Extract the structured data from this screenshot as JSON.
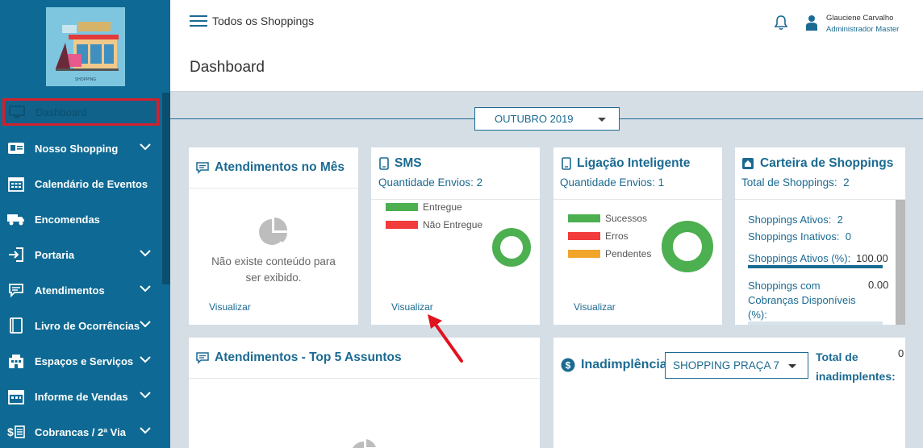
{
  "header": {
    "title": "Todos os Shoppings",
    "page_title": "Dashboard",
    "user_name": "Glauciene Carvalho",
    "user_role": "Administrador Master"
  },
  "sidebar": {
    "logo_caption": "SHOPPING",
    "items": [
      {
        "label": "Dashboard",
        "icon": "monitor-icon",
        "active": true
      },
      {
        "label": "Nosso Shopping",
        "icon": "id-card-icon",
        "expandable": true
      },
      {
        "label": "Calendário de Eventos",
        "icon": "calendar-icon"
      },
      {
        "label": "Encomendas",
        "icon": "truck-icon"
      },
      {
        "label": "Portaria",
        "icon": "door-enter-icon",
        "expandable": true
      },
      {
        "label": "Atendimentos",
        "icon": "chat-icon",
        "expandable": true
      },
      {
        "label": "Livro de Ocorrências",
        "icon": "book-icon",
        "expandable": true
      },
      {
        "label": "Espaços e Serviços",
        "icon": "building-icon",
        "expandable": true
      },
      {
        "label": "Informe de Vendas",
        "icon": "store-icon",
        "expandable": true
      },
      {
        "label": "Cobrancas / 2ª Via",
        "icon": "dollar-list-icon",
        "expandable": true
      }
    ]
  },
  "month_selector": {
    "value": "OUTUBRO 2019"
  },
  "cards": {
    "atendimentos_mes": {
      "title": "Atendimentos no Mês",
      "empty_line1": "Não existe conteúdo para",
      "empty_line2": "ser exibido.",
      "link": "Visualizar"
    },
    "sms": {
      "title": "SMS",
      "sub_label": "Quantidade Envios:",
      "sub_value": "2",
      "legend": [
        {
          "label": "Entregue",
          "color": "#4caf50"
        },
        {
          "label": "Não Entregue",
          "color": "#f23b3b"
        }
      ],
      "link": "Visualizar"
    },
    "ligacao": {
      "title": "Ligação Inteligente",
      "sub_label": "Quantidade Envios:",
      "sub_value": "1",
      "legend": [
        {
          "label": "Sucessos",
          "color": "#4caf50"
        },
        {
          "label": "Erros",
          "color": "#f23b3b"
        },
        {
          "label": "Pendentes",
          "color": "#f2a52b"
        }
      ],
      "link": "Visualizar"
    },
    "carteira": {
      "title": "Carteira de Shoppings",
      "sub_label": "Total de Shoppings:",
      "sub_value": "2",
      "ativos_label": "Shoppings Ativos:",
      "ativos_value": "2",
      "inativos_label": "Shoppings Inativos:",
      "inativos_value": "0",
      "ativos_pct_label": "Shoppings Ativos (%):",
      "ativos_pct_value": "100.00",
      "ativos_pct": 100,
      "cobrancas_line1": "Shoppings com",
      "cobrancas_line2": "Cobranças Disponíveis",
      "cobrancas_line3": "(%):",
      "cobrancas_value": "0.00"
    },
    "top5": {
      "title": "Atendimentos - Top 5 Assuntos"
    },
    "inadimplencia": {
      "title": "Inadimplência",
      "select_value": "SHOPPING PRAÇA 7",
      "total_line1": "Total de",
      "total_line2": "inadimplentes:",
      "total_value": "0"
    }
  },
  "colors": {
    "sidebar": "#0e6a94",
    "accent": "#1b6a92",
    "success": "#4caf50",
    "error": "#f23b3b",
    "pending": "#f2a52b",
    "annotation": "#e0141e"
  }
}
